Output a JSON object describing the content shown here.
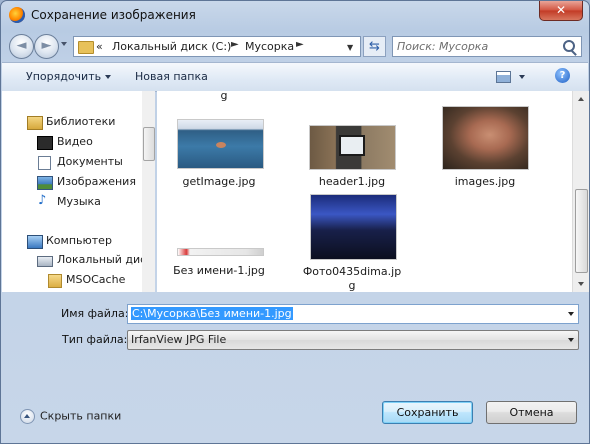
{
  "window": {
    "title": "Сохранение изображения",
    "close_label": "✕"
  },
  "nav": {
    "address": {
      "segments": [
        "Локальный диск (C:)",
        "Мусорка"
      ],
      "overflow": "«"
    },
    "search": {
      "placeholder": "Поиск: Мусорка"
    }
  },
  "toolbar": {
    "organize_label": "Упорядочить",
    "new_folder_label": "Новая папка",
    "help_label": "?"
  },
  "sidebar": {
    "items": [
      {
        "label": "Библиотеки",
        "icon": "libraries-icon"
      },
      {
        "label": "Видео",
        "icon": "video-icon"
      },
      {
        "label": "Документы",
        "icon": "documents-icon"
      },
      {
        "label": "Изображения",
        "icon": "pictures-icon"
      },
      {
        "label": "Музыка",
        "icon": "music-icon"
      },
      {
        "label": "Компьютер",
        "icon": "computer-icon"
      },
      {
        "label": "Локальный диск",
        "icon": "local-disk-icon"
      },
      {
        "label": "MSOCache",
        "icon": "folder-icon"
      }
    ]
  },
  "files": {
    "cut_top_label": "g",
    "items": [
      {
        "name": "getImage.jpg",
        "thumb": "icy-water-swimmer"
      },
      {
        "name": "header1.jpg",
        "thumb": "desk-monitor"
      },
      {
        "name": "images.jpg",
        "thumb": "pig"
      },
      {
        "name": "Без имени-1.jpg",
        "thumb": "web-banner"
      },
      {
        "name_line1": "Фото0435dima.jp",
        "name_line2": "g",
        "thumb": "night-stadium"
      }
    ]
  },
  "form": {
    "filename_label": "Имя файла:",
    "filename_value": "C:\\Мусорка\\Без имени-1.jpg",
    "filetype_label": "Тип файла:",
    "filetype_value": "IrfanView JPG File"
  },
  "footer": {
    "hide_folders_label": "Скрыть папки",
    "save_label": "Сохранить",
    "cancel_label": "Отмена"
  },
  "colors": {
    "selection": "#3399ff",
    "frame": "#b8cbe3",
    "save_button": "#bee6fd"
  }
}
